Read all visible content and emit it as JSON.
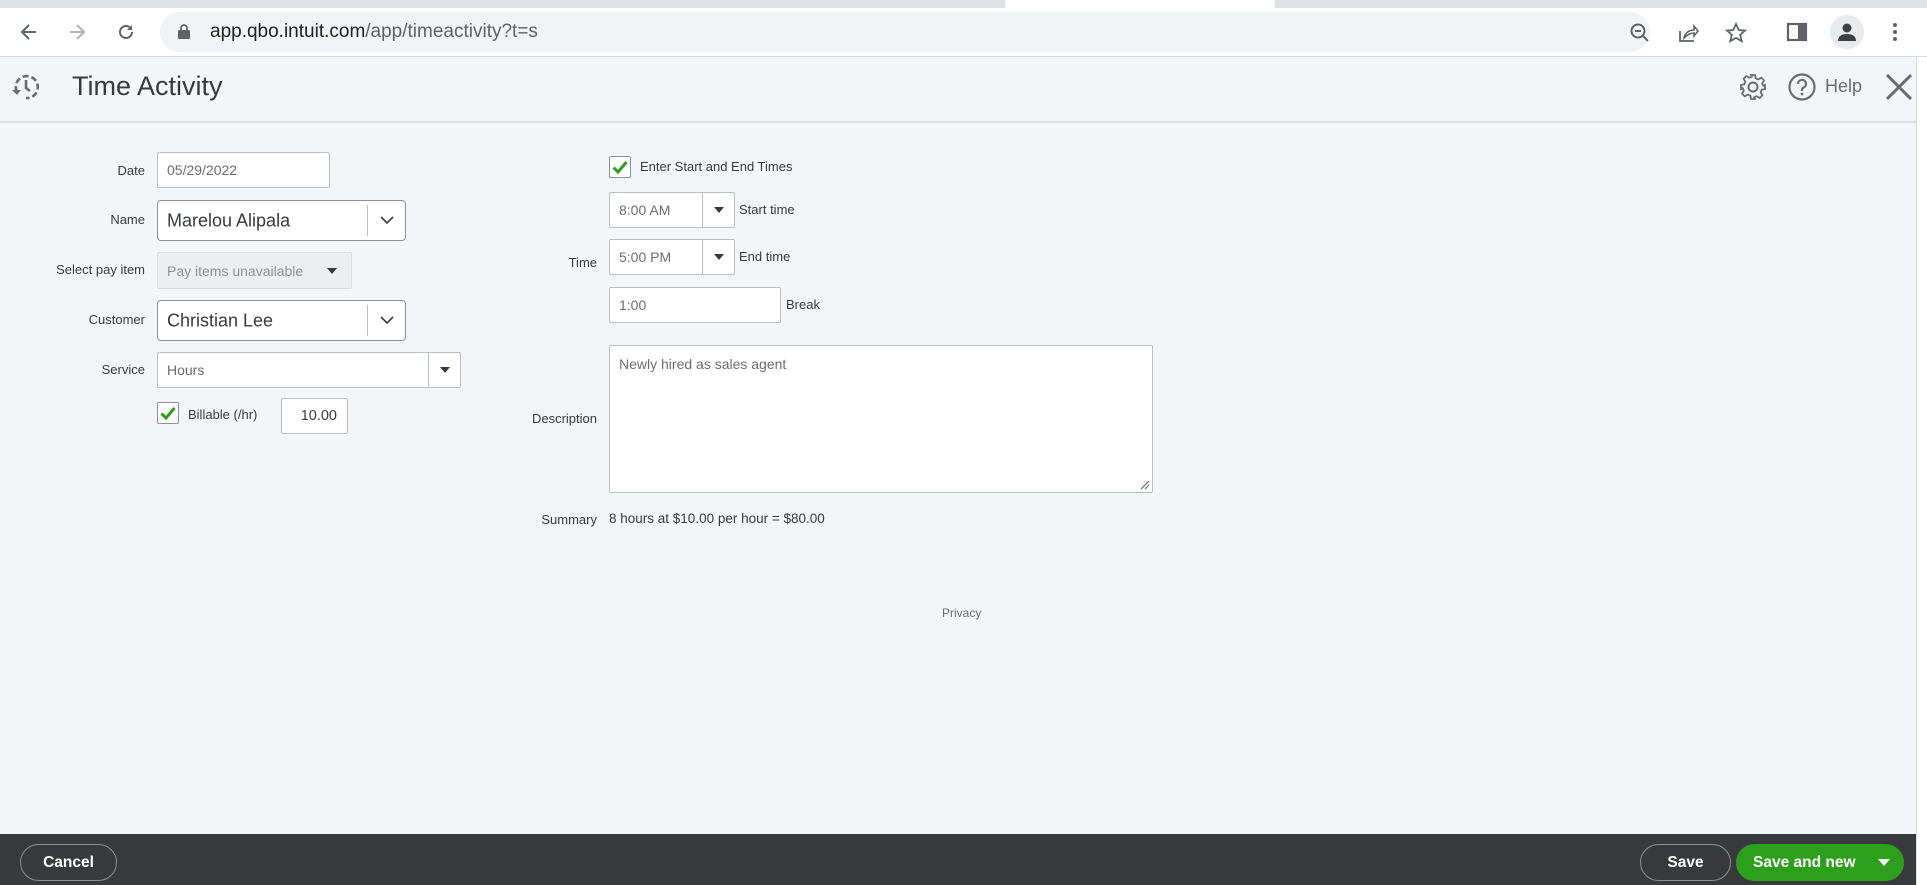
{
  "browser": {
    "url_host": "app.qbo.intuit.com",
    "url_path": "/app/timeactivity?t=s"
  },
  "header": {
    "title": "Time Activity",
    "help_label": "Help"
  },
  "form": {
    "date": {
      "label": "Date",
      "value": "05/29/2022"
    },
    "name": {
      "label": "Name",
      "value": "Marelou Alipala"
    },
    "pay_item": {
      "label": "Select pay item",
      "value": "Pay items unavailable"
    },
    "customer": {
      "label": "Customer",
      "value": "Christian Lee"
    },
    "service": {
      "label": "Service",
      "value": "Hours"
    },
    "billable": {
      "label": "Billable (/hr)",
      "checked": true,
      "rate": "10.00"
    },
    "enter_times": {
      "label": "Enter Start and End Times",
      "checked": true
    },
    "time_label": "Time",
    "start_time": {
      "label": "Start time",
      "value": "8:00 AM"
    },
    "end_time": {
      "label": "End time",
      "value": "5:00 PM"
    },
    "break_time": {
      "label": "Break",
      "value": "1:00"
    },
    "description": {
      "label": "Description",
      "value": "Newly hired as sales agent"
    },
    "summary": {
      "label": "Summary",
      "value": "8 hours at $10.00 per hour = $80.00"
    }
  },
  "privacy_link": "Privacy",
  "footer": {
    "cancel": "Cancel",
    "save": "Save",
    "save_and_new": "Save and new"
  },
  "colors": {
    "accent_green": "#2ca01c",
    "footer_bg": "#393a3d",
    "page_bg": "#f4f5f8"
  }
}
